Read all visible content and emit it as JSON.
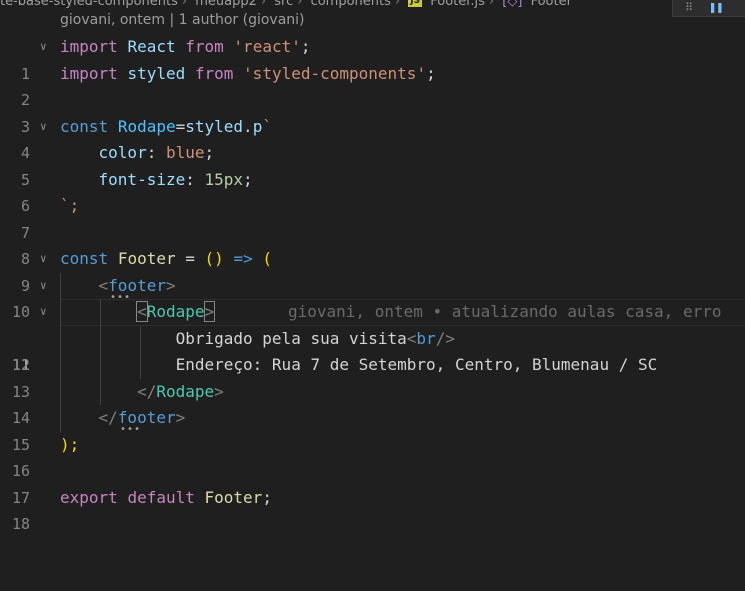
{
  "breadcrumb": {
    "items": [
      "te-base-styled-components",
      "meuapp2",
      "src",
      "components",
      "Footer.js",
      "Footer"
    ],
    "js_badge": "JS",
    "symbol_icon": "symbol-method-icon"
  },
  "blame_header": "giovani, ontem | 1 author (giovani)",
  "debug_toolbar": {
    "drag_icon": "drag-handle-icon",
    "pause_icon": "pause-icon"
  },
  "editor": {
    "line_numbers": [
      "1",
      "2",
      "3",
      "4",
      "5",
      "6",
      "7",
      "8",
      "9",
      "10",
      "11",
      "12",
      "13",
      "14",
      "15",
      "16",
      "17",
      "18"
    ],
    "active_line": 11,
    "inline_blame": "giovani, ontem • atualizando aulas casa, erro",
    "tokens": {
      "import": "import",
      "react": "React",
      "from": "from",
      "react_str": "'react'",
      "semicolon": ";",
      "styled": "styled",
      "styled_str": "'styled-components'",
      "const": "const",
      "rodape": "Rodape",
      "eq": "=",
      "styled_p": "styled",
      "dot": ".",
      "p": "p",
      "backtick": "`",
      "color_prop": "color",
      "colon": ":",
      "blue": "blue",
      "font_size_prop": "font-size",
      "px15": "15px",
      "close_tpl": "`;",
      "footer": "Footer",
      "eq_sp": " = ",
      "lparen": "(",
      "rparen": ")",
      "arrow": "=>",
      "lt": "<",
      "gt": ">",
      "lt_slash": "</",
      "footer_tag": "footer",
      "rodape_tag": "Rodape",
      "obrigado": "Obrigado pela sua visita",
      "br_open": "<",
      "br": "br",
      "br_close": "/>",
      "endereco": "Endereço: Rua 7 de Setembro, Centro, Blumenau / SC",
      "close_paren_semi": ");",
      "export": "export",
      "default": "default",
      "footer_export": "Footer"
    }
  }
}
